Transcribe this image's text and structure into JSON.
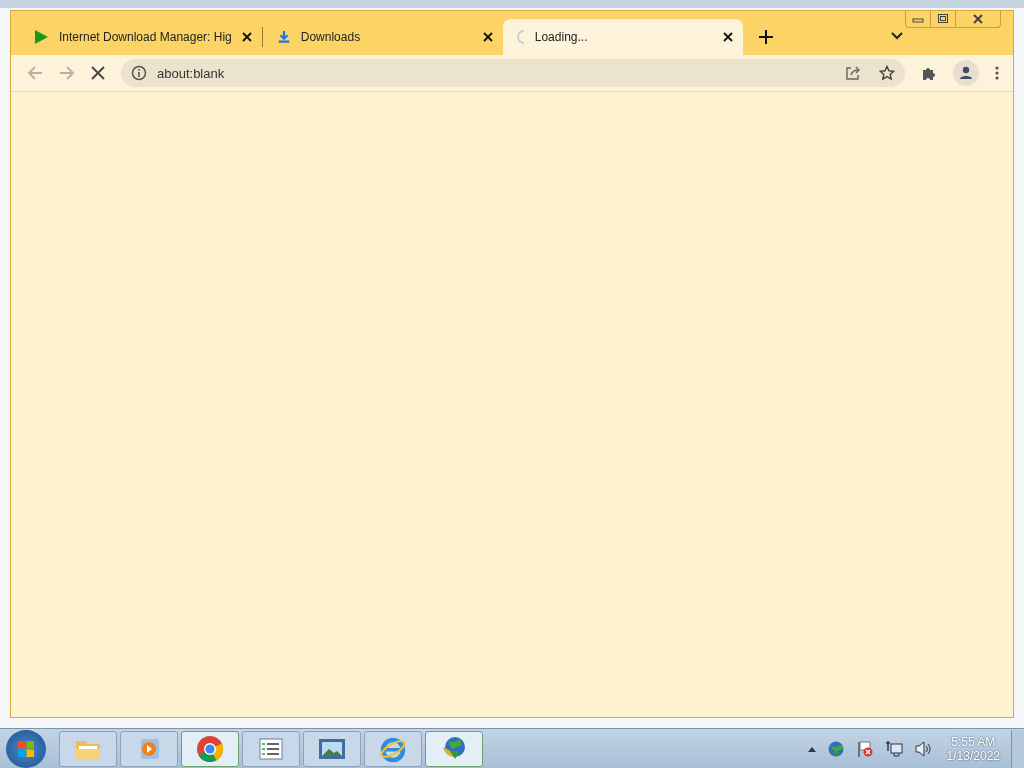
{
  "tabs": [
    {
      "title": "Internet Download Manager: Hig",
      "kind": "idm",
      "selected": false
    },
    {
      "title": "Downloads",
      "kind": "download",
      "selected": false
    },
    {
      "title": "Loading...",
      "kind": "spinner",
      "selected": true
    }
  ],
  "toolbar": {
    "back_disabled": true,
    "forward_disabled": true,
    "loading": true
  },
  "address": {
    "value": "about:blank"
  },
  "taskbar": {
    "items": [
      {
        "kind": "folder",
        "running": false
      },
      {
        "kind": "media",
        "running": false
      },
      {
        "kind": "chrome",
        "running": true
      },
      {
        "kind": "list",
        "running": false
      },
      {
        "kind": "photo",
        "running": false
      },
      {
        "kind": "ie",
        "running": false
      },
      {
        "kind": "idm",
        "running": true
      }
    ],
    "clock": {
      "time": "5:55 AM",
      "date": "1/13/2022"
    }
  }
}
